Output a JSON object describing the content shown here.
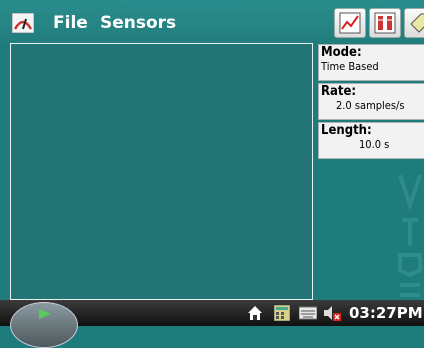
{
  "menubar": {
    "file_label": "File",
    "sensors_label": "Sensors"
  },
  "toolbar": {
    "graph_icon": "graph-view-icon",
    "meter_icon": "meter-view-icon",
    "tag_icon": "tag-icon"
  },
  "settings": {
    "mode": {
      "title": "Mode:",
      "value": "Time Based"
    },
    "rate": {
      "title": "Rate:",
      "value": "2.0 samples/s"
    },
    "length": {
      "title": "Length:",
      "value": "10.0 s"
    }
  },
  "taskbar": {
    "clock": "03:27PM"
  },
  "colors": {
    "background": "#1f7c7c",
    "panel": "#237575",
    "accent": "#cc2222"
  }
}
